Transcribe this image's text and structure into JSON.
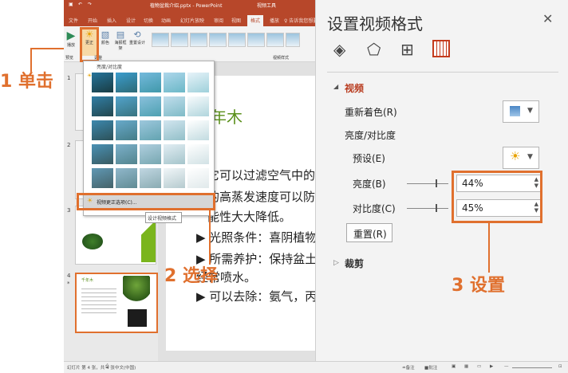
{
  "title_bar": {
    "file_name": "植物盆栽介绍.pptx - PowerPoint",
    "tool_context": "视频工具"
  },
  "ribbon_tabs": [
    "文件",
    "开始",
    "插入",
    "设计",
    "切换",
    "动画",
    "幻灯片放映",
    "审阅",
    "视图",
    "格式",
    "播放"
  ],
  "ribbon_tab_active": "格式",
  "ribbon_tab_tellme": "♀ 告诉我您想要...",
  "ribbon": {
    "play_label": "播放",
    "corrections_label": "更正",
    "color_label": "颜色",
    "poster_label": "海报框架",
    "reset_label": "重置设计",
    "group_preview": "预览",
    "group_adjust": "调整",
    "group_styles": "视频样式"
  },
  "gallery": {
    "header": "亮度/对比度",
    "options_item": "视频更正选项(C)...",
    "tooltip": "设计视频格式"
  },
  "slides": [
    {
      "num": "1"
    },
    {
      "num": "2"
    },
    {
      "num": "3"
    },
    {
      "num": "4",
      "star": "*",
      "title": "千年木"
    }
  ],
  "slide_body": {
    "title": "年木",
    "line1": "它可以过滤空气中的有",
    "line2": "的高蒸发速度可以防",
    "line3": "能性大大降低。",
    "bullet1": "▶ 光照条件：喜阴植物，",
    "bullet2a": "▶ 所需养护：保持盆土湿",
    "bullet2b": "  经常喷水。",
    "bullet3": "▶ 可以去除：氨气，丙酮"
  },
  "status": {
    "slide_info": "幻灯片 第 4 张，共 4 张",
    "chinese": "中文(中国)",
    "notes": "≐备注",
    "comments": "■批注",
    "zoom": "—"
  },
  "pane": {
    "title": "设置视频格式",
    "close": "✕",
    "dropdown_arrow": "▼",
    "section_video": "视频",
    "recolor": "重新着色(R)",
    "brightness_contrast": "亮度/对比度",
    "presets": "预设(E)",
    "brightness": "亮度(B)",
    "brightness_value": "44%",
    "contrast": "对比度(C)",
    "contrast_value": "45%",
    "reset": "重置(R)",
    "section_crop": "裁剪"
  },
  "callouts": {
    "step1": "1 单击",
    "step2": "2 选择",
    "step3": "3 设置"
  },
  "colors": {
    "accent_orange": "#e0702e",
    "ribbon_red": "#b7472a",
    "section_red": "#b83b1e",
    "slide_green": "#7ab51d"
  }
}
